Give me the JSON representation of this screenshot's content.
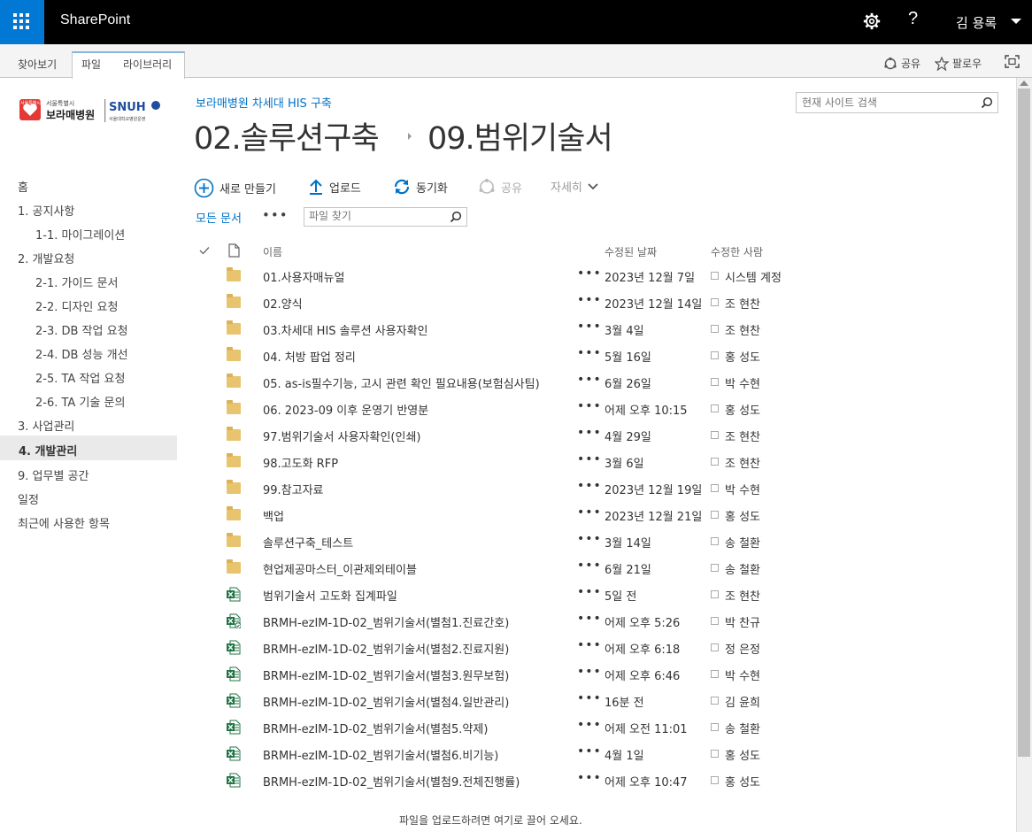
{
  "suite": {
    "brand": "SharePoint",
    "help": "?",
    "user": "김 용록"
  },
  "ribbon": {
    "tabs": [
      "찾아보기",
      "파일",
      "라이브러리"
    ],
    "share": "공유",
    "follow": "팔로우"
  },
  "site": {
    "title": "보라매병원 차세대 HIS 구축",
    "search_placeholder": "현재 사이트 검색"
  },
  "logo": {
    "small_top": "서울특별시",
    "hospital": "보라매병원",
    "badge_small": "서울특별시",
    "snuh": "SNUH",
    "snuh_sub": "서울대학교병원운영"
  },
  "breadcrumb": {
    "parent": "02.솔루션구축",
    "current": "09.범위기술서"
  },
  "nav": [
    {
      "label": "홈",
      "level": 0,
      "selected": false
    },
    {
      "label": "1. 공지사항",
      "level": 0,
      "selected": false
    },
    {
      "label": "1-1. 마이그레이션",
      "level": 1,
      "selected": false
    },
    {
      "label": "2. 개발요청",
      "level": 0,
      "selected": false
    },
    {
      "label": "2-1. 가이드 문서",
      "level": 1,
      "selected": false
    },
    {
      "label": "2-2. 디자인 요청",
      "level": 1,
      "selected": false
    },
    {
      "label": "2-3. DB 작업 요청",
      "level": 1,
      "selected": false
    },
    {
      "label": "2-4. DB 성능 개선",
      "level": 1,
      "selected": false
    },
    {
      "label": "2-5. TA 작업 요청",
      "level": 1,
      "selected": false
    },
    {
      "label": "2-6. TA 기술 문의",
      "level": 1,
      "selected": false
    },
    {
      "label": "3. 사업관리",
      "level": 0,
      "selected": false
    },
    {
      "label": "4. 개발관리",
      "level": 0,
      "selected": true
    },
    {
      "label": "9. 업무별 공간",
      "level": 0,
      "selected": false
    },
    {
      "label": "일정",
      "level": 0,
      "selected": false
    },
    {
      "label": "최근에 사용한 항목",
      "level": 0,
      "selected": false
    }
  ],
  "commands": {
    "new": "새로 만들기",
    "upload": "업로드",
    "sync": "동기화",
    "share": "공유",
    "more": "자세히"
  },
  "view": {
    "label": "모든 문서",
    "more": "•••",
    "search_placeholder": "파일 찾기"
  },
  "columns": {
    "name": "이름",
    "modified": "수정된 날짜",
    "modified_by": "수정한 사람"
  },
  "files": [
    {
      "type": "folder",
      "name": "01.사용자매뉴얼",
      "modified": "2023년 12월 7일",
      "author": "시스템 계정"
    },
    {
      "type": "folder",
      "name": "02.양식",
      "modified": "2023년 12월 14일",
      "author": "조 현찬"
    },
    {
      "type": "folder",
      "name": "03.차세대 HIS 솔루션 사용자확인",
      "modified": "3월 4일",
      "author": "조 현찬"
    },
    {
      "type": "folder",
      "name": "04. 처방 팝업 정리",
      "modified": "5월 16일",
      "author": "홍 성도"
    },
    {
      "type": "folder",
      "name": "05. as-is필수기능, 고시 관련 확인 필요내용(보험심사팀)",
      "modified": "6월 26일",
      "author": "박 수현"
    },
    {
      "type": "folder",
      "name": "06. 2023-09 이후 운영기 반영분",
      "modified": "어제 오후 10:15",
      "author": "홍 성도"
    },
    {
      "type": "folder",
      "name": "97.범위기술서 사용자확인(인쇄)",
      "modified": "4월 29일",
      "author": "조 현찬"
    },
    {
      "type": "folder",
      "name": "98.고도화 RFP",
      "modified": "3월 6일",
      "author": "조 현찬"
    },
    {
      "type": "folder",
      "name": "99.참고자료",
      "modified": "2023년 12월 19일",
      "author": "박 수현"
    },
    {
      "type": "folder",
      "name": "백업",
      "modified": "2023년 12월 21일",
      "author": "홍 성도"
    },
    {
      "type": "folder",
      "name": "솔루션구축_테스트",
      "modified": "3월 14일",
      "author": "송 철환"
    },
    {
      "type": "folder",
      "name": "현업제공마스터_이관제외테이블",
      "modified": "6월 21일",
      "author": "송 철환"
    },
    {
      "type": "excel",
      "name": "범위기술서 고도화 집계파일",
      "modified": "5일 전",
      "author": "조 현찬"
    },
    {
      "type": "excel-shared",
      "name": "BRMH-ezIM-1D-02_범위기술서(별첨1.진료간호)",
      "modified": "어제 오후 5:26",
      "author": "박 찬규"
    },
    {
      "type": "excel",
      "name": "BRMH-ezIM-1D-02_범위기술서(별첨2.진료지원)",
      "modified": "어제 오후 6:18",
      "author": "정 은정"
    },
    {
      "type": "excel",
      "name": "BRMH-ezIM-1D-02_범위기술서(별첨3.원무보험)",
      "modified": "어제 오후 6:46",
      "author": "박 수현"
    },
    {
      "type": "excel",
      "name": "BRMH-ezIM-1D-02_범위기술서(별첨4.일반관리)",
      "modified": "16분 전",
      "author": "김 윤희"
    },
    {
      "type": "excel",
      "name": "BRMH-ezIM-1D-02_범위기술서(별첨5.약제)",
      "modified": "어제 오전 11:01",
      "author": "송 철환"
    },
    {
      "type": "excel",
      "name": "BRMH-ezIM-1D-02_범위기술서(별첨6.비기능)",
      "modified": "4월 1일",
      "author": "홍 성도"
    },
    {
      "type": "excel",
      "name": "BRMH-ezIM-1D-02_범위기술서(별첨9.전체진행률)",
      "modified": "어제 오후 10:47",
      "author": "홍 성도"
    }
  ],
  "row_dots": "•••",
  "drop_hint": "파일을 업로드하려면 여기로 끌어 오세요.",
  "colors": {
    "accent": "#0072c6",
    "waffle": "#0078d4",
    "folder": "#e8c46e",
    "excel": "#217346"
  }
}
